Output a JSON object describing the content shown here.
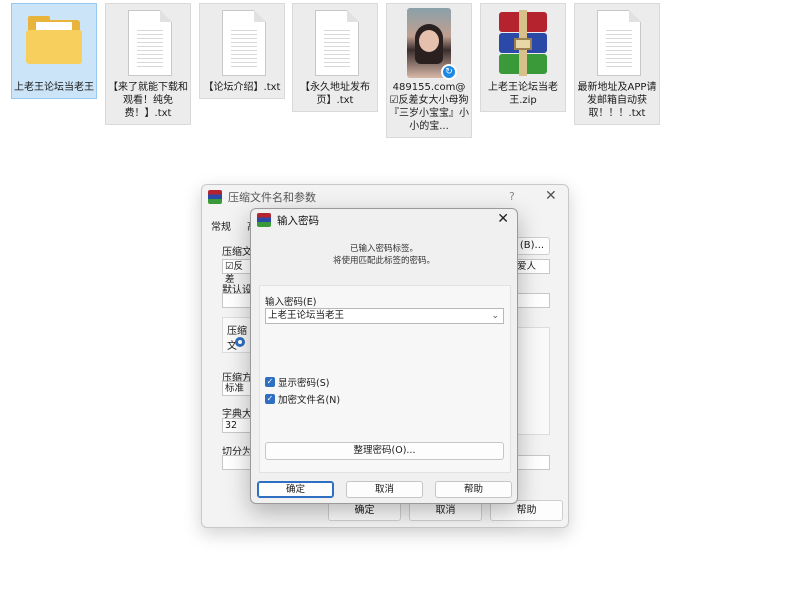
{
  "files": [
    {
      "label": "上老王论坛当老王",
      "kind": "folder"
    },
    {
      "label": "【来了就能下载和观看！纯免费！】.txt",
      "kind": "text"
    },
    {
      "label": "【论坛介绍】.txt",
      "kind": "text"
    },
    {
      "label": "【永久地址发布页】.txt",
      "kind": "text"
    },
    {
      "label": "489155.com@☑反差女大小母狗『三岁小宝宝』小小的宝...",
      "kind": "image"
    },
    {
      "label": "上老王论坛当老王.zip",
      "kind": "archive"
    },
    {
      "label": "最新地址及APP请发邮箱自动获取！！！.txt",
      "kind": "text"
    }
  ],
  "back_window": {
    "title": "压缩文件名和参数",
    "help_glyph": "?",
    "tab_general": "常规",
    "tab_second": "高",
    "archive_name_label": "压缩文",
    "archive_name_value": "☑反差",
    "default_label": "默认设",
    "format_label": "压缩文",
    "method_label": "压缩方",
    "method_value": "标准",
    "dict_label": "字典大",
    "dict_value": "32",
    "split_label": "切分为",
    "browse_button": "(B)...",
    "profile_value": "爱人",
    "ok_button": "确定",
    "cancel_button": "取消",
    "help_button": "帮助"
  },
  "dialog": {
    "title": "输入密码",
    "info_line1": "已输入密码标签。",
    "info_line2": "将使用匹配此标签的密码。",
    "password_label": "输入密码(E)",
    "password_value": "上老王论坛当老王",
    "show_password": "显示密码(S)",
    "encrypt_filenames": "加密文件名(N)",
    "organize_button": "整理密码(O)...",
    "ok_button": "确定",
    "cancel_button": "取消",
    "help_button": "帮助"
  }
}
